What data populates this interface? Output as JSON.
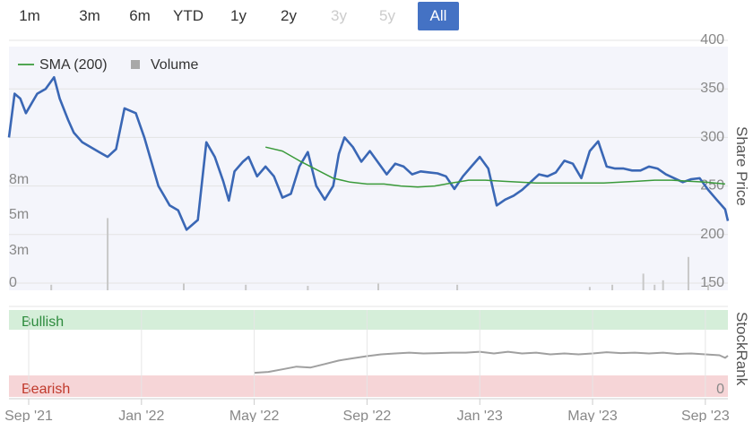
{
  "range_selector": {
    "buttons": [
      {
        "label": "1m",
        "state": "normal"
      },
      {
        "label": "3m",
        "state": "normal"
      },
      {
        "label": "6m",
        "state": "normal"
      },
      {
        "label": "YTD",
        "state": "normal"
      },
      {
        "label": "1y",
        "state": "normal"
      },
      {
        "label": "2y",
        "state": "normal"
      },
      {
        "label": "3y",
        "state": "disabled"
      },
      {
        "label": "5y",
        "state": "disabled"
      },
      {
        "label": "All",
        "state": "active"
      }
    ]
  },
  "legend": {
    "sma_label": "SMA (200)",
    "volume_label": "Volume"
  },
  "price_axis_title": "Share Price",
  "stockrank_axis_title": "StockRank",
  "band_labels": {
    "bullish": "Bullish",
    "bearish": "Bearish",
    "zero": "0"
  },
  "colors": {
    "price_line": "#3a67b5",
    "sma_line": "#3a9a3a",
    "volume_bar": "#c8c8c8",
    "rank_line": "#a0a0a0",
    "bullish_band": "#d5eed9",
    "bearish_band": "#f6d5d7",
    "bullish_text": "#2e8b3e",
    "bearish_text": "#c0392b",
    "active_button": "#4472c4"
  },
  "chart_data": [
    {
      "type": "line",
      "title": "",
      "ylabel": "Share Price",
      "ylim": [
        150,
        400
      ],
      "y_ticks": [
        150,
        200,
        250,
        300,
        350,
        400
      ],
      "volume_ticks": [
        "0",
        "3m",
        "5m",
        "8m"
      ],
      "x_ticks": [
        "Sep '21",
        "Jan '22",
        "May '22",
        "Sep '22",
        "Jan '23",
        "May '23",
        "Sep '23"
      ],
      "x_tick_times": [
        0,
        4,
        8,
        12,
        16,
        20,
        24
      ],
      "x_range": [
        -0.7,
        24.8
      ],
      "series": [
        {
          "name": "Share Price",
          "x": [
            -0.7,
            -0.5,
            -0.3,
            -0.1,
            0.3,
            0.6,
            0.9,
            1.1,
            1.4,
            1.6,
            1.9,
            2.2,
            2.5,
            2.8,
            3.1,
            3.4,
            3.8,
            4.1,
            4.4,
            4.6,
            4.8,
            5.0,
            5.3,
            5.6,
            6.0,
            6.3,
            6.6,
            6.9,
            7.1,
            7.3,
            7.6,
            7.8,
            8.1,
            8.4,
            8.7,
            9.0,
            9.3,
            9.6,
            9.9,
            10.2,
            10.5,
            10.8,
            11.0,
            11.2,
            11.5,
            11.8,
            12.1,
            12.4,
            12.7,
            13.0,
            13.3,
            13.6,
            13.9,
            14.2,
            14.5,
            14.8,
            15.1,
            15.4,
            15.7,
            16.0,
            16.3,
            16.6,
            16.9,
            17.2,
            17.5,
            17.8,
            18.1,
            18.4,
            18.7,
            19.0,
            19.3,
            19.6,
            19.9,
            20.2,
            20.5,
            20.8,
            21.1,
            21.4,
            21.7,
            22.0,
            22.3,
            22.6,
            22.9,
            23.2,
            23.5,
            23.8,
            24.1,
            24.4,
            24.7,
            24.8
          ],
          "y": [
            300,
            345,
            340,
            325,
            345,
            350,
            362,
            340,
            318,
            305,
            295,
            290,
            285,
            280,
            288,
            330,
            325,
            300,
            270,
            250,
            240,
            230,
            225,
            205,
            215,
            295,
            280,
            255,
            235,
            265,
            275,
            280,
            260,
            270,
            260,
            238,
            242,
            270,
            285,
            250,
            236,
            250,
            283,
            300,
            290,
            275,
            286,
            274,
            262,
            273,
            270,
            262,
            265,
            264,
            263,
            260,
            247,
            260,
            270,
            280,
            268,
            230,
            236,
            240,
            246,
            254,
            262,
            260,
            264,
            276,
            273,
            258,
            286,
            296,
            270,
            268,
            268,
            266,
            266,
            270,
            268,
            262,
            258,
            254,
            257,
            258,
            246,
            236,
            226,
            214
          ]
        },
        {
          "name": "SMA (200)",
          "x": [
            8.4,
            9.0,
            9.6,
            10.2,
            10.8,
            11.4,
            12.0,
            12.6,
            13.2,
            13.8,
            14.4,
            15.0,
            15.6,
            16.2,
            16.8,
            17.4,
            18.0,
            18.6,
            19.2,
            19.8,
            20.4,
            21.0,
            21.6,
            22.2,
            22.8,
            23.4,
            24.0,
            24.7
          ],
          "y": [
            290,
            286,
            276,
            267,
            258,
            254,
            252,
            252,
            250,
            249,
            250,
            253,
            256,
            256,
            255,
            254,
            253,
            253,
            253,
            253,
            253,
            254,
            255,
            256,
            256,
            255,
            254,
            252
          ]
        }
      ],
      "volume": {
        "x": [
          0.8,
          2.8,
          5.5,
          7.7,
          9.9,
          12.4,
          15.2,
          19.9,
          20.7,
          21.8,
          22.2,
          22.5,
          23.4,
          24.1
        ],
        "values": [
          0.5,
          6.5,
          0.6,
          0.5,
          0.4,
          0.6,
          0.5,
          0.3,
          0.5,
          1.5,
          0.5,
          0.9,
          3.0,
          0.5
        ]
      }
    },
    {
      "type": "line",
      "title": "",
      "ylabel": "StockRank",
      "ylim": [
        0,
        100
      ],
      "series": [
        {
          "name": "StockRank",
          "x": [
            8.0,
            8.5,
            9.0,
            9.5,
            10.0,
            10.5,
            11.0,
            11.5,
            12.0,
            12.5,
            13.0,
            13.5,
            14.0,
            14.5,
            15.0,
            15.5,
            16.0,
            16.5,
            17.0,
            17.5,
            18.0,
            18.5,
            19.0,
            19.5,
            20.0,
            20.5,
            21.0,
            21.5,
            22.0,
            22.5,
            23.0,
            23.5,
            24.0,
            24.5,
            24.7,
            24.8
          ],
          "y": [
            10,
            12,
            18,
            24,
            22,
            30,
            38,
            43,
            48,
            52,
            54,
            56,
            54,
            55,
            56,
            56,
            58,
            54,
            58,
            54,
            56,
            52,
            54,
            52,
            54,
            57,
            55,
            56,
            54,
            56,
            53,
            54,
            52,
            50,
            44,
            49
          ]
        }
      ]
    }
  ]
}
